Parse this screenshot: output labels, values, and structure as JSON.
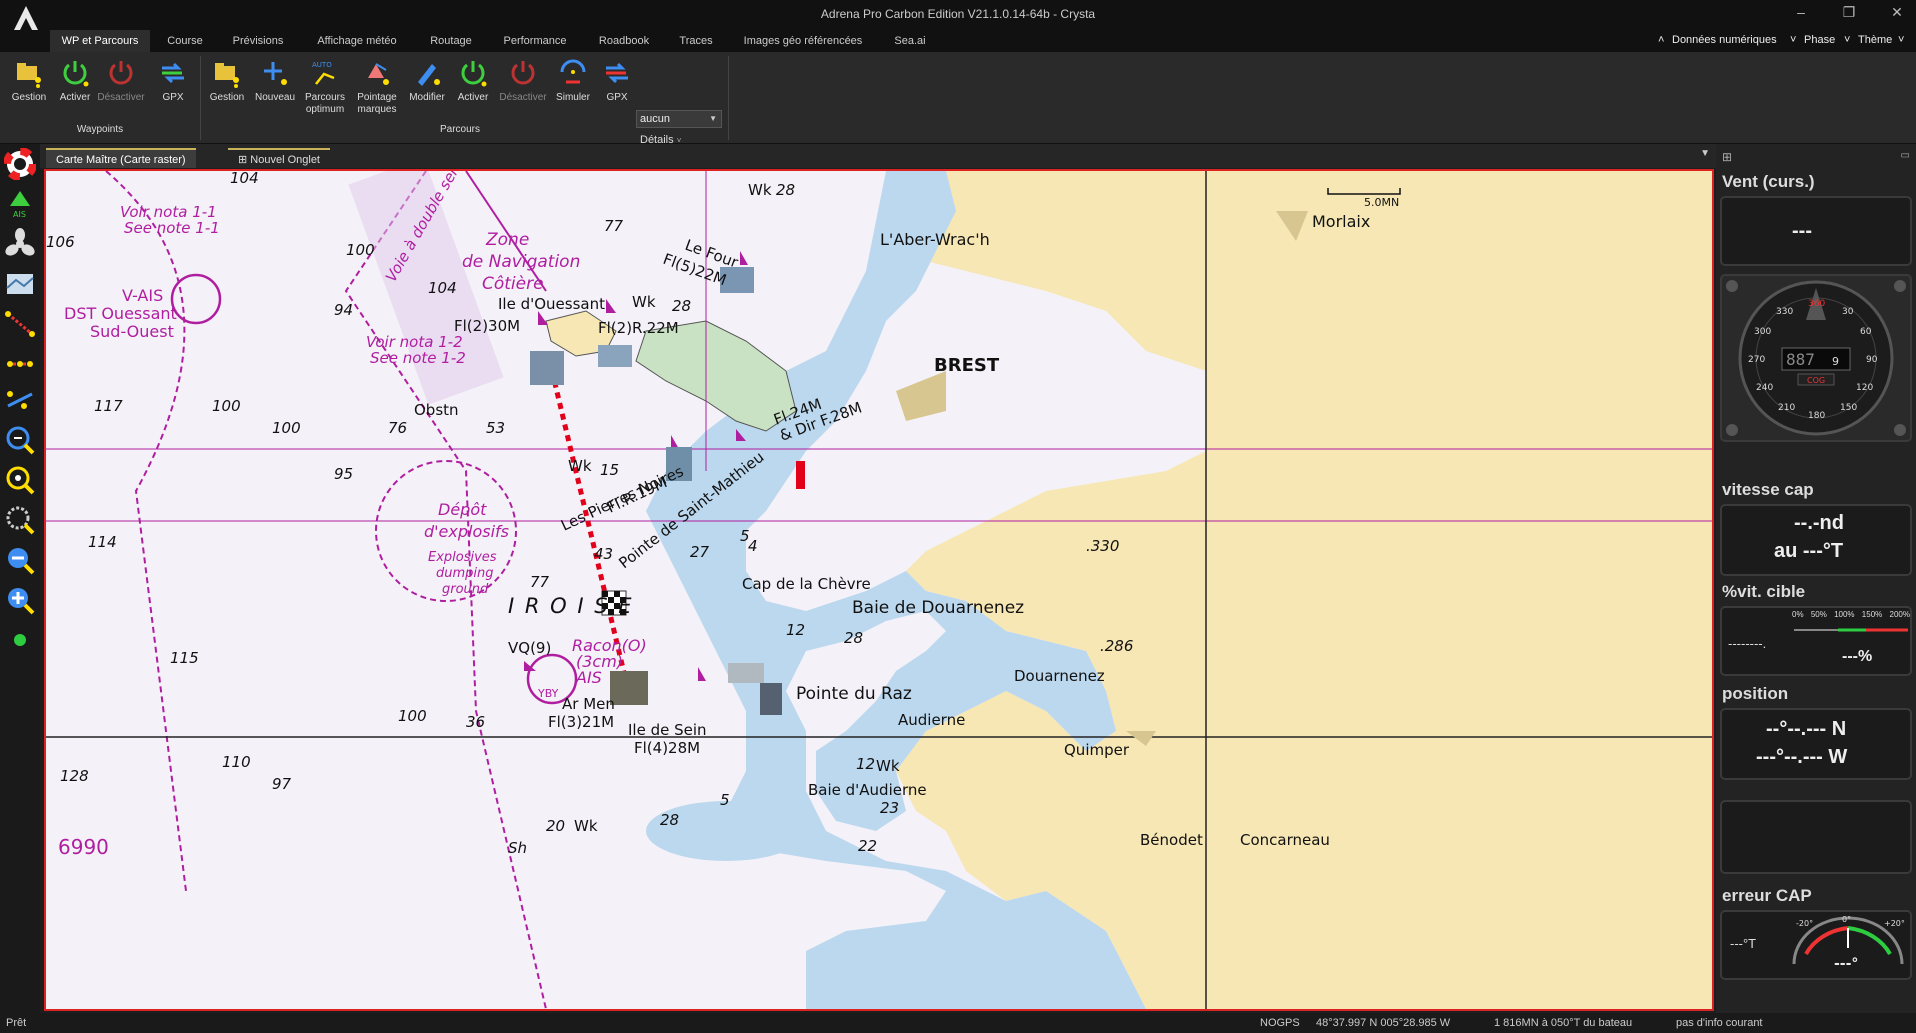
{
  "app": {
    "title": "Adrena Pro Carbon Edition V21.1.0.14-64b - Crysta",
    "logo_letter": "A"
  },
  "window_controls": {
    "minimize": "–",
    "maximize": "❐",
    "close": "✕"
  },
  "menu": {
    "tabs": [
      "WP et Parcours",
      "Course",
      "Prévisions",
      "Affichage météo",
      "Routage",
      "Performance",
      "Roadbook",
      "Traces",
      "Images géo référencées",
      "Sea.ai"
    ],
    "right": [
      "Données numériques",
      "Phase",
      "Thème"
    ]
  },
  "ribbon": {
    "waypoints": {
      "group_label": "Waypoints",
      "buttons": [
        {
          "label": "Gestion",
          "icon": "folder-waypoint-icon"
        },
        {
          "label": "Activer",
          "icon": "power-on-icon"
        },
        {
          "label": "Désactiver",
          "icon": "power-off-icon"
        },
        {
          "label": "GPX",
          "icon": "gpx-transfer-icon"
        }
      ]
    },
    "parcours": {
      "group_label": "Parcours",
      "buttons": [
        {
          "label": "Gestion",
          "icon": "folder-route-icon"
        },
        {
          "label": "Nouveau",
          "icon": "new-route-icon"
        },
        {
          "label": "Parcours optimum",
          "icon": "auto-route-icon"
        },
        {
          "label": "Pointage marques",
          "icon": "marks-icon"
        },
        {
          "label": "Modifier",
          "icon": "edit-route-icon"
        },
        {
          "label": "Activer",
          "icon": "power-on-icon"
        },
        {
          "label": "Désactiver",
          "icon": "power-off-icon"
        },
        {
          "label": "Simuler",
          "icon": "simulate-icon"
        },
        {
          "label": "GPX",
          "icon": "gpx-transfer-icon"
        }
      ],
      "select_value": "aucun",
      "details_label": "Détails"
    }
  },
  "doc_tabs": [
    "Carte Maître (Carte raster)",
    "Nouvel Onglet"
  ],
  "map": {
    "scale_label": "5.0MN",
    "chart_number": "6990",
    "labels": {
      "voir_nota_11": "Voir nota 1-1",
      "see_note_11": "See note 1-1",
      "v_ais": "V-AIS",
      "dst": "DST Ouessant",
      "sud_ouest": "Sud-Ouest",
      "voie": "Voie à double sens",
      "zone": "Zone",
      "zone2": "de Navigation",
      "zone3": "Côtière",
      "ile_ouessant": "Ile d'Ouessant",
      "fl2_30m": "Fl(2)30M",
      "fl2_r22m": "Fl(2)R.22M",
      "voir_nota_12": "Voir nota 1-2",
      "see_note_12": "See note 1-2",
      "obstn": "Obstn",
      "le_four": "Le Four",
      "fl5_22m": "Fl(5)22M",
      "aber": "L'Aber-Wrac'h",
      "morlaix": "Morlaix",
      "brest": "BREST",
      "fl24m": "Fl.24M",
      "dir28m": "& Dir F.28M",
      "depot": "Dépôt",
      "explosifs": "d'explosifs",
      "explosives": "Explosives",
      "dumping": "dumping",
      "ground": "ground",
      "flr19m": "Fl.R.19M",
      "pierres_noires": "Les Pierres Noires",
      "saint_mathieu": "Pointe de Saint-Mathieu",
      "cap_chevre": "Cap de la Chèvre",
      "baie_douarnenez": "Baie de Douarnenez",
      "douarnenez": "Douarnenez",
      "iroise": "I R O I S E",
      "vq9": "VQ(9)",
      "racon": "Racon(O)",
      "racon2": "(3cm)",
      "ais": "AIS",
      "yby": "YBY",
      "ar_men": "Ar Men",
      "fl3_21m": "Fl(3)21M",
      "ile_sein": "Ile de Sein",
      "fl4_28m": "Fl(4)28M",
      "pointe_raz": "Pointe du Raz",
      "audierne": "Audierne",
      "quimper": "Quimper",
      "baie_audierne": "Baie d'Audierne",
      "benodet": "Bénodet",
      "concarneau": "Concarneau",
      "wk": "Wk",
      "sh": "Sh"
    },
    "depths": [
      "104",
      "106",
      "100",
      "94",
      "104",
      "77",
      "117",
      "100",
      "100",
      "76",
      "53",
      "95",
      "114",
      "43",
      "27",
      "5",
      "4",
      "77",
      "115",
      "12",
      "28",
      "36",
      "100",
      "110",
      "128",
      "97",
      "28",
      "5",
      "20",
      "23",
      "22",
      "12",
      "15",
      "28",
      "28",
      ".330",
      ".286"
    ]
  },
  "right_panel": {
    "wind_title": "Vent (curs.)",
    "wind_value": "---",
    "compass": {
      "heading_display": "887",
      "heading_sub": "9",
      "cog_label": "COG",
      "marks": [
        "360",
        "30",
        "60",
        "90",
        "120",
        "150",
        "180",
        "210",
        "240",
        "270",
        "300",
        "330"
      ]
    },
    "speed_title": "vitesse cap",
    "speed_line1": "--.-nd",
    "speed_line2": "au ---°T",
    "target_title": "%vit. cible",
    "target_scale": [
      "0%",
      "50%",
      "100%",
      "150%",
      "200%"
    ],
    "target_left": "--------.",
    "target_value": "---%",
    "position_title": "position",
    "position_lat": "--°--.--- N",
    "position_lon": "---°--.--- W",
    "cap_title": "erreur CAP",
    "cap_left": "---°T",
    "cap_scale": [
      "-20°",
      "0°",
      "+20°"
    ],
    "cap_value": "---°"
  },
  "status": {
    "ready": "Prêt",
    "gps": "NOGPS",
    "coords": "48°37.997 N  005°28.985 W",
    "distance": "1 816MN à 050°T du bateau",
    "info": "pas d'info courant"
  },
  "colors": {
    "land": "#f7e7b4",
    "shallow": "#bcd8ee",
    "deep": "#f3f1f8",
    "magenta": "#b01ea0",
    "route_red": "#e3001b"
  }
}
